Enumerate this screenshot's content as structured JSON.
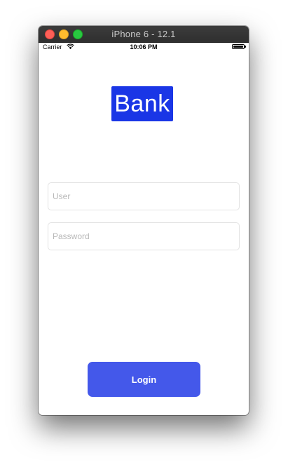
{
  "window": {
    "title": "iPhone 6 - 12.1"
  },
  "status_bar": {
    "carrier": "Carrier",
    "time": "10:06 PM"
  },
  "logo": {
    "text": "Bank",
    "color": "#1a36e6"
  },
  "form": {
    "user": {
      "placeholder": "User",
      "value": ""
    },
    "password": {
      "placeholder": "Password",
      "value": ""
    }
  },
  "login_button": {
    "label": "Login",
    "color": "#4458ea"
  }
}
